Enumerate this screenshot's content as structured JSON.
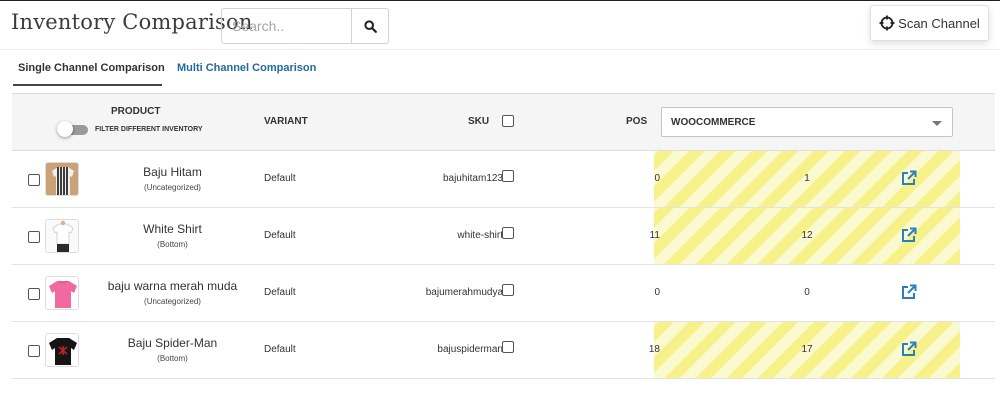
{
  "header": {
    "title": "Inventory Comparison",
    "search_placeholder": "Search..",
    "search_icon": "search-icon",
    "scan_button_label": "Scan Channel",
    "scan_icon": "crosshair-icon"
  },
  "tabs": [
    {
      "label": "Single Channel Comparison",
      "active": true
    },
    {
      "label": "Multi Channel Comparison",
      "active": false
    }
  ],
  "table": {
    "columns": {
      "product": "PRODUCT",
      "filter_label": "FILTER DIFFERENT INVENTORY",
      "variant": "VARIANT",
      "sku": "SKU",
      "pos": "POS",
      "channel_selected": "WOOCOMMERCE"
    },
    "rows": [
      {
        "name": "Baju Hitam",
        "category": "(Uncategorized)",
        "variant": "Default",
        "sku": "bajuhitam123",
        "pos": "0",
        "channel": "1",
        "mismatch": true
      },
      {
        "name": "White Shirt",
        "category": "(Bottom)",
        "variant": "Default",
        "sku": "white-shirt",
        "pos": "11",
        "channel": "12",
        "mismatch": true
      },
      {
        "name": "baju warna merah muda",
        "category": "(Uncategorized)",
        "variant": "Default",
        "sku": "bajumerahmudya",
        "pos": "0",
        "channel": "0",
        "mismatch": false
      },
      {
        "name": "Baju Spider-Man",
        "category": "(Bottom)",
        "variant": "Default",
        "sku": "bajuspiderman",
        "pos": "18",
        "channel": "17",
        "mismatch": true
      }
    ]
  },
  "colors": {
    "mismatch_stripe_a": "#f6f189",
    "mismatch_stripe_b": "#fbf9d0",
    "link_blue": "#1f6c9a",
    "icon_blue": "#2a7fc1"
  }
}
